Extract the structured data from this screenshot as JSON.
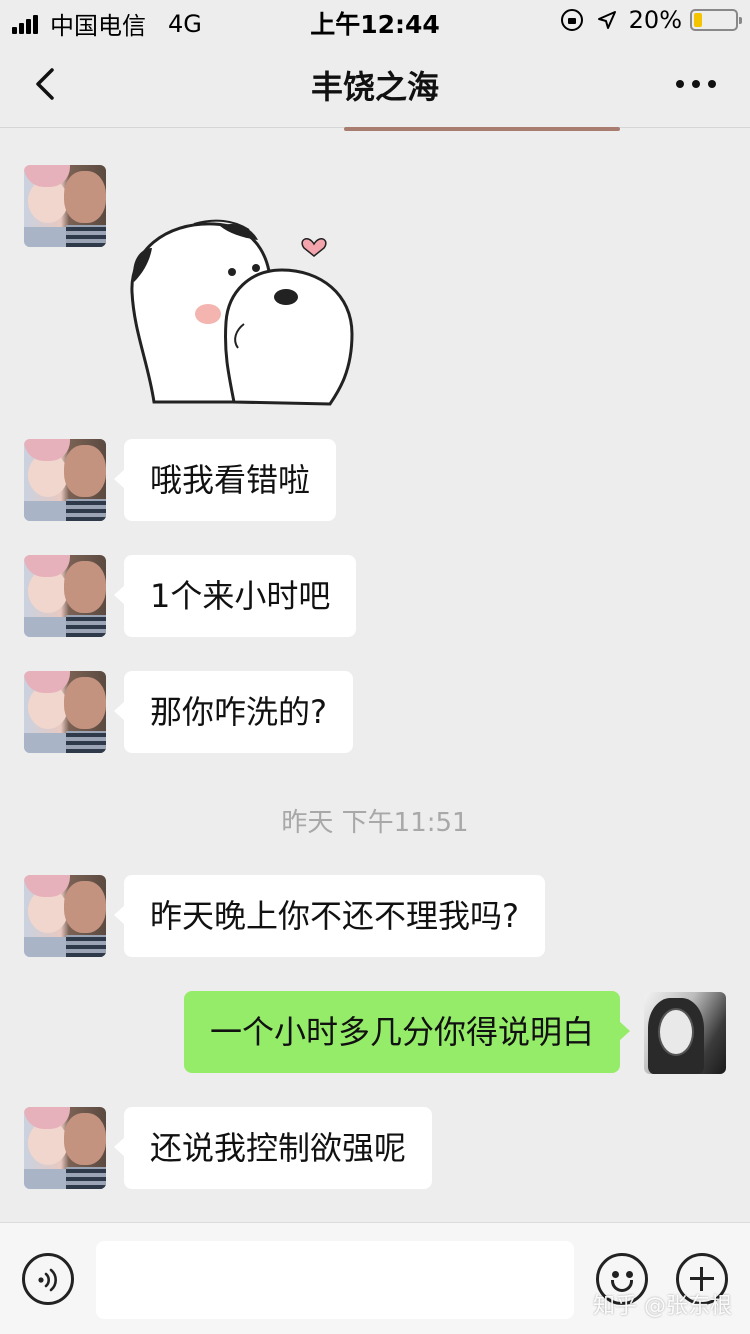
{
  "status_bar": {
    "carrier": "中国电信",
    "network": "4G",
    "time": "上午12:44",
    "battery": "20%",
    "battery_level": 0.2
  },
  "nav": {
    "title": "丰饶之海",
    "back_icon": "chevron-left-icon",
    "more_icon": "more-dots-icon"
  },
  "messages": [
    {
      "from": "other",
      "type": "sticker",
      "text": ""
    },
    {
      "from": "other",
      "type": "text",
      "text": "哦我看错啦"
    },
    {
      "from": "other",
      "type": "text",
      "text": "1个来小时吧"
    },
    {
      "from": "other",
      "type": "text",
      "text": "那你咋洗的?"
    },
    {
      "from": "other",
      "type": "text",
      "text": "昨天晚上你不还不理我吗?"
    },
    {
      "from": "me",
      "type": "text",
      "text": "一个小时多几分你得说明白"
    },
    {
      "from": "other",
      "type": "text",
      "text": "还说我控制欲强呢"
    }
  ],
  "timestamp": "昨天 下午11:51",
  "input_bar": {
    "placeholder": "",
    "voice_icon": "voice-icon",
    "emoji_icon": "emoji-icon",
    "plus_icon": "plus-icon"
  },
  "watermark": "知乎 @张东根",
  "colors": {
    "background": "#ededed",
    "my_bubble": "#95ec69",
    "other_bubble": "#ffffff"
  }
}
